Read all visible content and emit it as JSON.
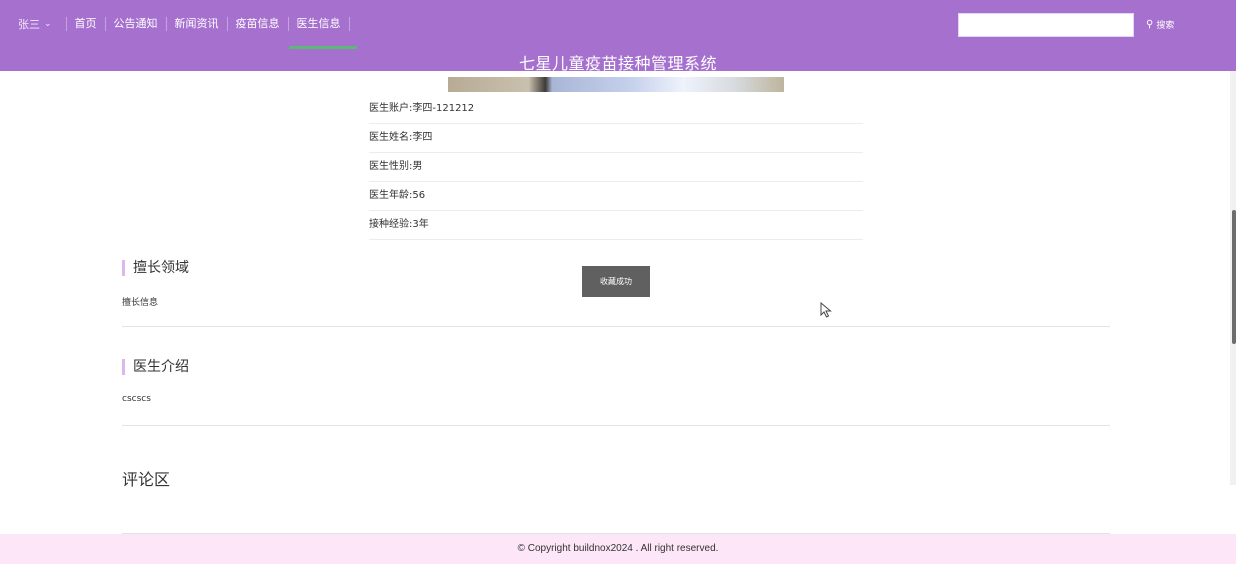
{
  "nav": {
    "user_name": "张三",
    "items": [
      "首页",
      "公告通知",
      "新闻资讯",
      "疫苗信息",
      "医生信息"
    ],
    "active_index": 4
  },
  "search": {
    "value": "",
    "button_label": "搜索"
  },
  "site_title": "七星儿童疫苗接种管理系统",
  "doctor_info": [
    "医生账户:李四-121212",
    "医生姓名:李四",
    "医生性别:男",
    "医生年龄:56",
    "接种经验:3年"
  ],
  "sections": [
    {
      "title": "擅长领域",
      "content": "擅长信息"
    },
    {
      "title": "医生介绍",
      "content": "cscscs"
    }
  ],
  "comments": {
    "title": "评论区"
  },
  "toast": "收藏成功",
  "footer": "© Copyright buildnox2024 . All right reserved.",
  "colors": {
    "header_bg": "#a670cf",
    "active_underline": "#5cb874",
    "section_marker": "#dcb7ee",
    "footer_bg": "#fce6f8"
  }
}
